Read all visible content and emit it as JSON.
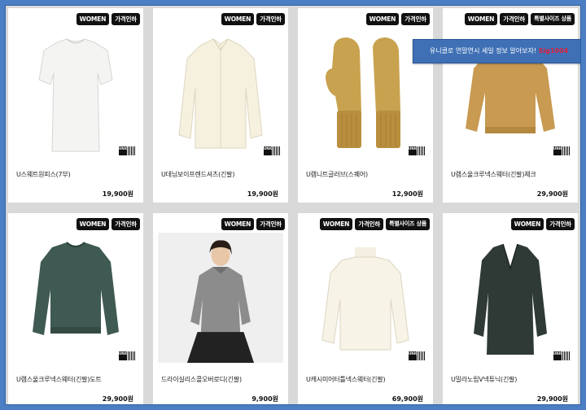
{
  "banner": {
    "text": "유니클로 연말연시 세일 정보 알아보자!",
    "highlight": "Sig1004"
  },
  "products": [
    {
      "badges": [
        "WOMEN",
        "가격인하"
      ],
      "name": "U스웨트원피스(7부)",
      "price": "19,900원",
      "image": "white-dress"
    },
    {
      "badges": [
        "WOMEN",
        "가격인하"
      ],
      "name": "U데님보이프렌드셔츠(긴팔)",
      "price": "19,900원",
      "image": "cream-shirt"
    },
    {
      "badges": [
        "WOMEN",
        "가격인하"
      ],
      "name": "U램니트글러브(스퀘어)",
      "price": "12,900원",
      "image": "mustard-mittens"
    },
    {
      "badges": [
        "WOMEN",
        "가격인하",
        "특별사이즈 상품"
      ],
      "name": "U램스울크루넥스웨터(긴팔)체크",
      "price": "29,900원",
      "image": "mustard-sweater"
    },
    {
      "badges": [
        "WOMEN",
        "가격인하"
      ],
      "name": "U램스울크루넥스웨터(긴팔)도트",
      "price": "29,900원",
      "image": "green-sweater"
    },
    {
      "badges": [
        "WOMEN",
        "가격인하"
      ],
      "name": "드라이실리스콜오버로디(긴팔)",
      "price": "9,900원",
      "image": "gray-top-model"
    },
    {
      "badges": [
        "WOMEN",
        "가격인하",
        "특별사이즈 상품"
      ],
      "name": "U캐시미어터틀넥스웨터(긴팔)",
      "price": "69,900원",
      "image": "white-turtleneck"
    },
    {
      "badges": [
        "WOMEN",
        "가격인하"
      ],
      "name": "U밀라노립V넥튜닉(긴팔)",
      "price": "29,900원",
      "image": "green-tunic"
    }
  ],
  "logo_text": "UNI QLO"
}
